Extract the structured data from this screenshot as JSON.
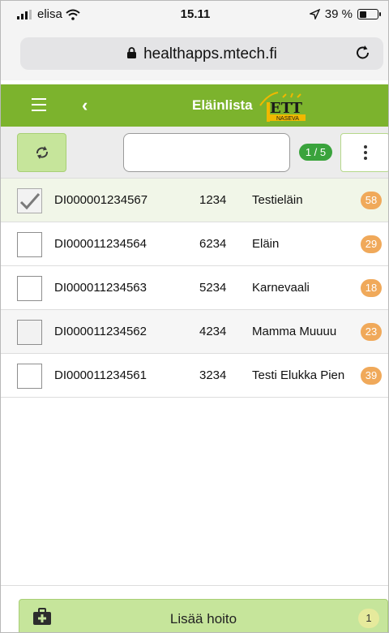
{
  "status_bar": {
    "carrier": "elisa",
    "time": "15.11",
    "battery_text": "39 %",
    "battery_level": 0.39
  },
  "browser": {
    "url": "healthapps.mtech.fi"
  },
  "app_header": {
    "title": "Eläinlista",
    "logo_top": "ETT",
    "logo_bottom": "NASEVA",
    "brand_color": "#7cb32d"
  },
  "toolbar": {
    "search_value": "",
    "search_placeholder": "",
    "page_indicator": "1 / 5"
  },
  "animals": [
    {
      "id": "DI000001234567",
      "number": "1234",
      "name": "Testieläin",
      "count": "58",
      "checked": true
    },
    {
      "id": "DI000011234564",
      "number": "6234",
      "name": "Eläin",
      "count": "29",
      "checked": false
    },
    {
      "id": "DI000011234563",
      "number": "5234",
      "name": "Karnevaali",
      "count": "18",
      "checked": false
    },
    {
      "id": "DI000011234562",
      "number": "4234",
      "name": "Mamma Muuuu",
      "count": "23",
      "checked": false
    },
    {
      "id": "DI000011234561",
      "number": "3234",
      "name": "Testi Elukka Pien",
      "count": "39",
      "checked": false
    }
  ],
  "bottom": {
    "add_label": "Lisää hoito",
    "add_count": "1"
  },
  "colors": {
    "badge_orange": "#f0a95a",
    "page_badge_green": "#3aa33c",
    "button_light_green": "#c6e59b"
  }
}
